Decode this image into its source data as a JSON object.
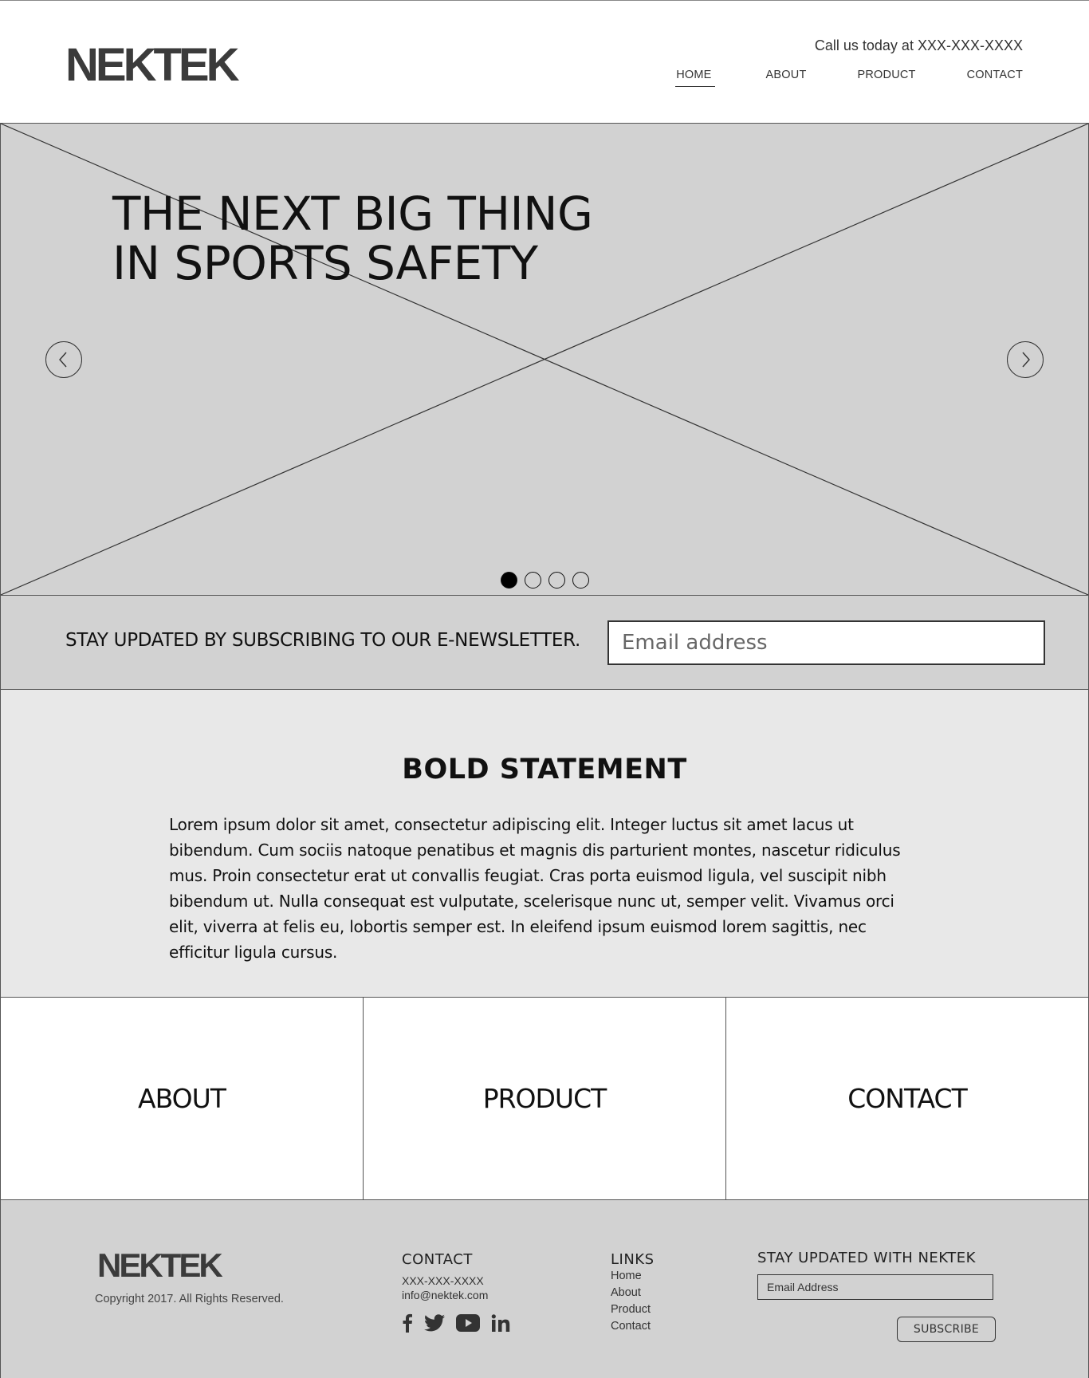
{
  "header": {
    "logo": "NEKTEK",
    "phone": "Call us today at XXX-XXX-XXXX",
    "nav": [
      {
        "label": "HOME",
        "active": true
      },
      {
        "label": "ABOUT"
      },
      {
        "label": "PRODUCT"
      },
      {
        "label": "CONTACT"
      }
    ]
  },
  "hero": {
    "title_line1": "THE NEXT BIG THING",
    "title_line2": "IN SPORTS SAFETY",
    "slide_count": 4,
    "active_slide": 1
  },
  "newsletter": {
    "text": "STAY UPDATED BY SUBSCRIBING TO OUR E-NEWSLETTER.",
    "placeholder": "Email address"
  },
  "statement": {
    "title": "BOLD STATEMENT",
    "body": "Lorem ipsum dolor sit amet, consectetur adipiscing elit. Integer luctus sit amet lacus ut bibendum. Cum sociis natoque penatibus et magnis dis parturient montes, nascetur ridiculus mus. Proin consectetur erat ut convallis feugiat. Cras porta euismod ligula, vel suscipit nibh bibendum ut. Nulla consequat est vulputate, scelerisque nunc ut, semper velit. Vivamus orci elit, viverra at felis eu, lobortis semper est. In eleifend ipsum euismod lorem sagittis, nec efficitur ligula cursus."
  },
  "tiles": [
    {
      "label": "ABOUT"
    },
    {
      "label": "PRODUCT"
    },
    {
      "label": "CONTACT"
    }
  ],
  "footer": {
    "logo": "NEKTEK",
    "copyright": "Copyright 2017. All Rights Reserved.",
    "contact": {
      "title": "CONTACT",
      "phone": "XXX-XXX-XXXX",
      "email": "info@nektek.com"
    },
    "socials": [
      "facebook-icon",
      "twitter-icon",
      "youtube-icon",
      "linkedin-icon"
    ],
    "links": {
      "title": "LINKS",
      "items": [
        "Home",
        "About",
        "Product",
        "Contact"
      ]
    },
    "subscribe": {
      "title": "STAY UPDATED WITH NEKTEK",
      "placeholder": "Email Address",
      "button": "SUBSCRIBE"
    }
  },
  "colors": {
    "hero_bg": "#d2d2d2",
    "statement_bg": "#e8e8e8",
    "footer_bg": "#d2d2d2",
    "text": "#111111"
  }
}
